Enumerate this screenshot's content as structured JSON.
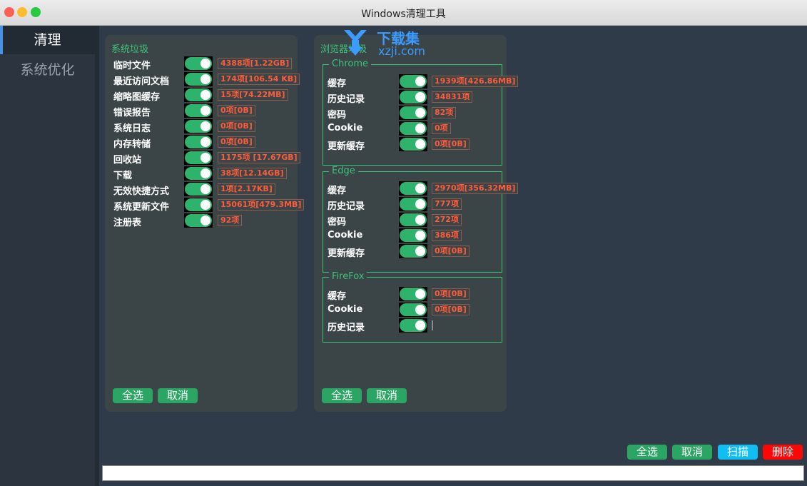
{
  "window": {
    "title": "Windows清理工具",
    "traffic_colors": [
      "#fe5f57",
      "#febc2e",
      "#28c840"
    ]
  },
  "sidebar": {
    "items": [
      {
        "label": "清理",
        "active": true
      },
      {
        "label": "系统优化",
        "active": false
      }
    ]
  },
  "system_panel": {
    "title": "系统垃圾",
    "items": [
      {
        "label": "临时文件",
        "count": "4388项[1.22GB]"
      },
      {
        "label": "最近访问文档",
        "count": "174项[106.54 KB]"
      },
      {
        "label": "缩略图缓存",
        "count": "15项[74.22MB]"
      },
      {
        "label": "错误报告",
        "count": "0项[0B]"
      },
      {
        "label": "系统日志",
        "count": "0项[0B]"
      },
      {
        "label": "内存转储",
        "count": "0项[0B]"
      },
      {
        "label": "回收站",
        "count": "1175项 [17.67GB]"
      },
      {
        "label": "下载",
        "count": "38项[12.14GB]"
      },
      {
        "label": "无效快捷方式",
        "count": "1项[2.17KB]"
      },
      {
        "label": "系统更新文件",
        "count": "15061项[479.3MB]"
      },
      {
        "label": "注册表",
        "count": "92项"
      }
    ],
    "select_all": "全选",
    "cancel": "取消"
  },
  "browser_panel": {
    "title": "浏览器垃圾",
    "chrome": {
      "name": "Chrome",
      "items": [
        {
          "label": "缓存",
          "count": "1939项[426.86MB]"
        },
        {
          "label": "历史记录",
          "count": "34831项"
        },
        {
          "label": "密码",
          "count": "82项"
        },
        {
          "label": "Cookie",
          "count": "0项"
        },
        {
          "label": "更新缓存",
          "count": "0项[0B]"
        }
      ]
    },
    "edge": {
      "name": "Edge",
      "items": [
        {
          "label": "缓存",
          "count": "2970项[356.32MB]"
        },
        {
          "label": "历史记录",
          "count": "777项"
        },
        {
          "label": "密码",
          "count": "272项"
        },
        {
          "label": "Cookie",
          "count": "386项"
        },
        {
          "label": "更新缓存",
          "count": "0项[0B]"
        }
      ]
    },
    "firefox": {
      "name": "FireFox",
      "items": [
        {
          "label": "缓存",
          "count": "0项[0B]"
        },
        {
          "label": "Cookie",
          "count": "0项[0B]"
        },
        {
          "label": "历史记录",
          "count": ""
        }
      ]
    },
    "select_all": "全选",
    "cancel": "取消"
  },
  "footer": {
    "select_all": "全选",
    "cancel": "取消",
    "scan": "扫描",
    "delete": "删除"
  },
  "watermark": {
    "text1": "下载集",
    "text2": "xzji.com"
  }
}
